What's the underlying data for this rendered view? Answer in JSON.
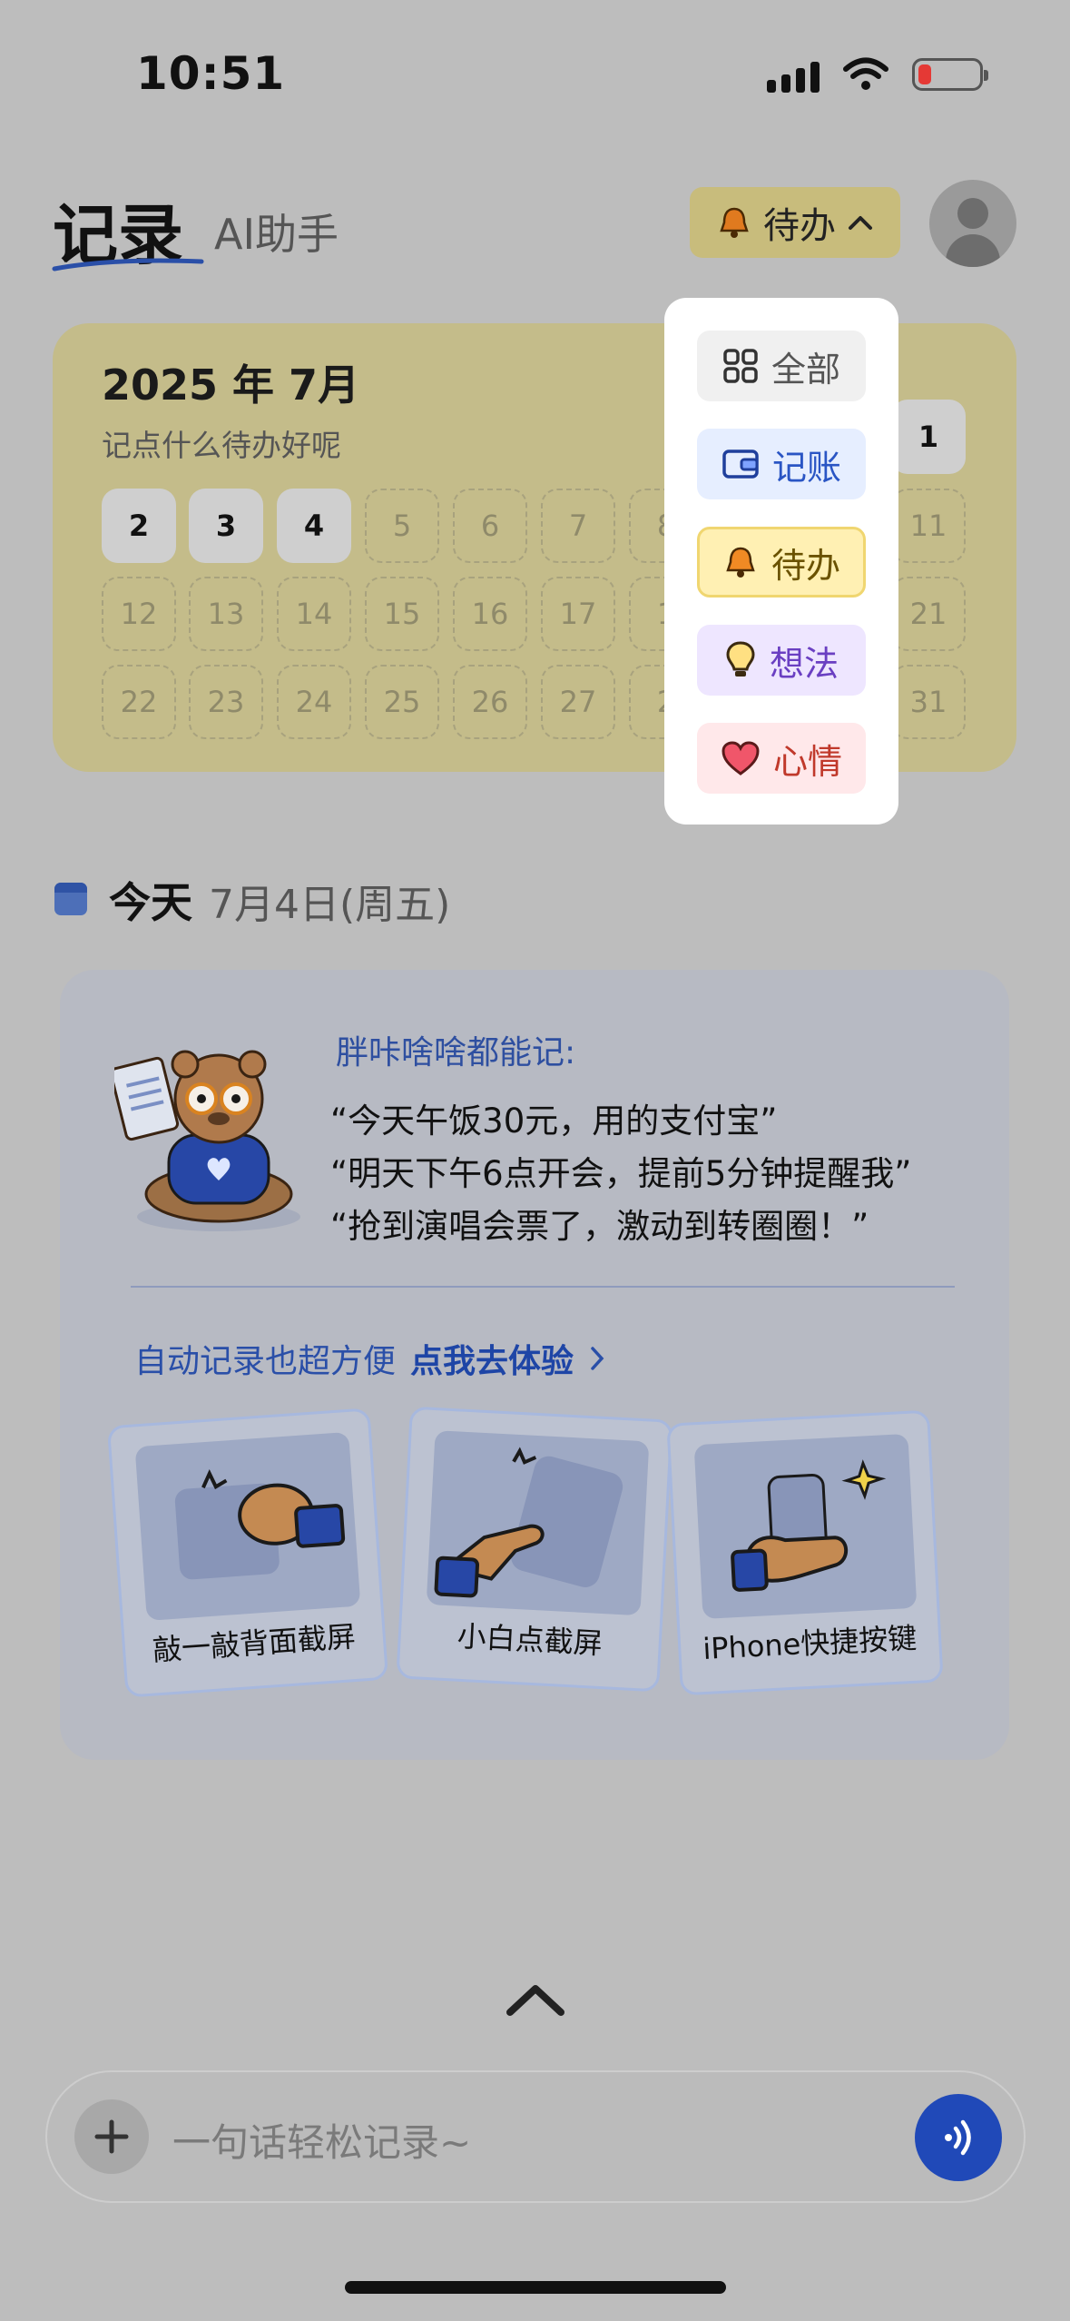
{
  "status_bar": {
    "time": "10:51"
  },
  "header": {
    "title": "记录",
    "subtitle": "AI助手",
    "filter_button": {
      "label": "待办",
      "icon": "bell-icon",
      "chevron": "^"
    }
  },
  "calendar": {
    "title": "2025 年 7月",
    "subtitle": "记点什么待办好呢",
    "days": [
      "1",
      "2",
      "3",
      "4",
      "5",
      "6",
      "7",
      "8",
      "11",
      "12",
      "13",
      "14",
      "15",
      "16",
      "17",
      "1",
      "21",
      "22",
      "23",
      "24",
      "25",
      "26",
      "27",
      "2",
      "31"
    ]
  },
  "dropdown": {
    "items": [
      {
        "label": "全部",
        "icon": "grid-icon",
        "color": "#555555",
        "bg": "#f0f0f0"
      },
      {
        "label": "记账",
        "icon": "wallet-icon",
        "color": "#2a55c4",
        "bg": "#e6eeff"
      },
      {
        "label": "待办",
        "icon": "bell-icon",
        "color": "#6a5200",
        "bg": "#fff0b3"
      },
      {
        "label": "想法",
        "icon": "bulb-icon",
        "color": "#6a3fc2",
        "bg": "#eee6ff"
      },
      {
        "label": "心情",
        "icon": "heart-icon",
        "color": "#c0392b",
        "bg": "#ffe8ea"
      }
    ]
  },
  "today": {
    "label": "今天",
    "date": "7月4日(周五)"
  },
  "info_card": {
    "heading": "胖咔啥啥都能记:",
    "quotes": [
      "“今天午饭30元，用的支付宝”",
      "“明天下午6点开会，提前5分钟提醒我”",
      "“抢到演唱会票了，激动到转圈圈！”"
    ],
    "auto_text": "自动记录也超方便",
    "auto_link": "点我去体验",
    "tiles": [
      {
        "caption": "敲一敲背面截屏"
      },
      {
        "caption": "小白点截屏"
      },
      {
        "caption": "iPhone快捷按键"
      }
    ]
  },
  "input": {
    "placeholder": "一句话轻松记录~"
  },
  "colors": {
    "accent": "#2049b8",
    "todo_bg": "#c8bc7c",
    "calendar_bg": "#c4bc8a"
  }
}
